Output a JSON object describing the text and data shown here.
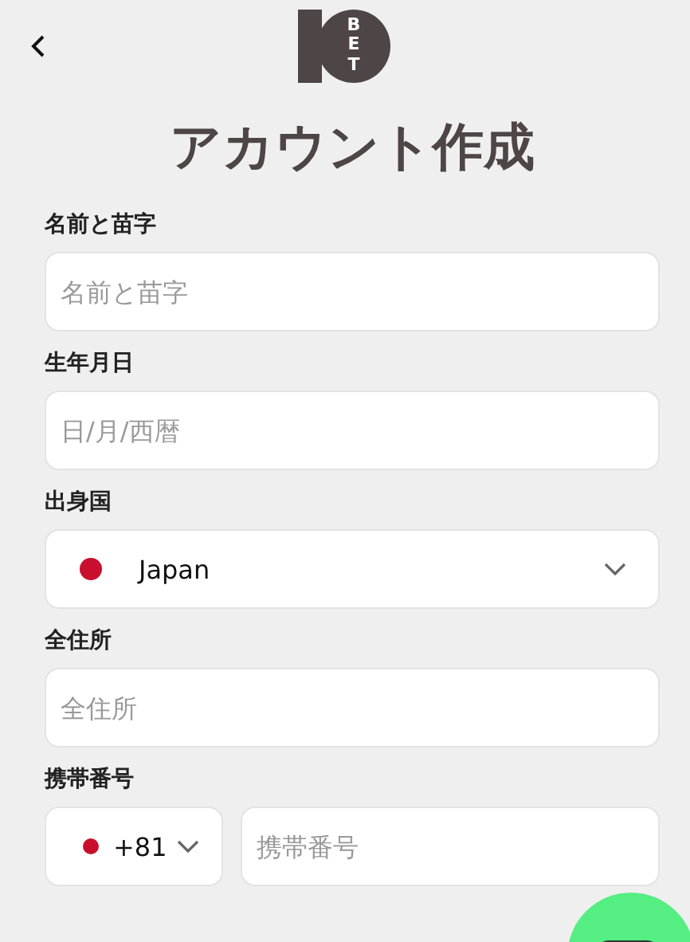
{
  "logo": {
    "text": "BET"
  },
  "title": "アカウント作成",
  "fields": [
    {
      "kind": "text",
      "label": "名前と苗字",
      "placeholder": "名前と苗字"
    },
    {
      "kind": "text",
      "label": "生年月日",
      "placeholder": "日/月/西暦"
    },
    {
      "kind": "select",
      "label": "出身国",
      "value": "Japan"
    },
    {
      "kind": "text",
      "label": "全住所",
      "placeholder": "全住所"
    },
    {
      "kind": "phone",
      "label": "携帯番号",
      "code": "+81",
      "placeholder": "携帯番号"
    }
  ]
}
